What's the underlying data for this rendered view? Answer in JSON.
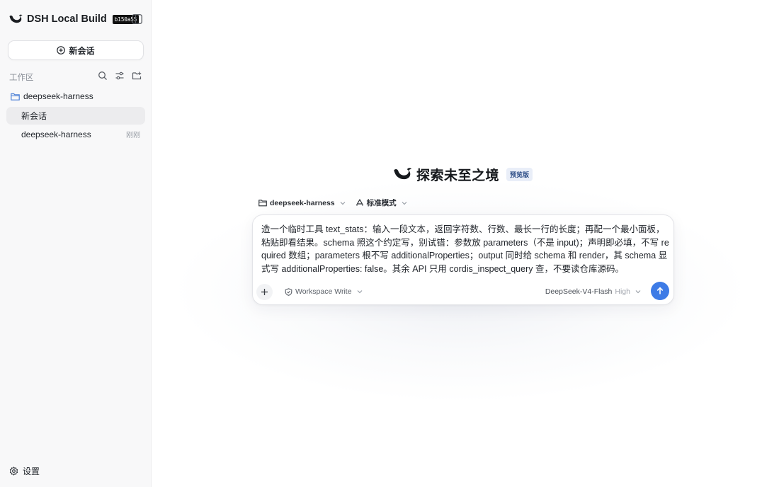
{
  "sidebar": {
    "brand_title": "DSH Local Build",
    "build_tag": "b150a55",
    "new_chat_label": "新会话",
    "workspace_label": "工作区",
    "folder_name": "deepseek-harness",
    "chats": [
      {
        "title": "新会话",
        "time": ""
      },
      {
        "title": "deepseek-harness",
        "time": "刚刚"
      }
    ],
    "settings_label": "设置"
  },
  "main": {
    "hero_title": "探索未至之境",
    "preview_badge": "预览版",
    "project_selector": "deepseek-harness",
    "mode_selector": "标准模式",
    "prompt_text": "造一个临时工具 text_stats：输入一段文本，返回字符数、行数、最长一行的长度；再配一个最小面板，粘贴即看结果。schema 照这个约定写，别试错：参数放 parameters（不是 input)；声明即必填，不写 required 数组；parameters 根不写 additionalProperties；output 同时给 schema 和 render，其 schema 显式写 additionalProperties: false。其余 API 只用 cordis_inspect_query 查，不要读仓库源码。",
    "permission_mode": "Workspace Write",
    "model_name": "DeepSeek-V4-Flash",
    "effort": "High"
  },
  "colors": {
    "accent": "#3d7be6",
    "sidebar_bg": "#f8f8f9",
    "badge_bg": "#e9eef8",
    "folder_icon": "#4a7fd6"
  },
  "icons": [
    "whale-logo-icon",
    "sidebar-toggle-icon",
    "plus-circle-icon",
    "search-icon",
    "sliders-icon",
    "new-folder-icon",
    "folder-icon",
    "gear-icon",
    "plus-icon",
    "shield-icon",
    "chevron-down-icon",
    "arrow-up-icon"
  ]
}
